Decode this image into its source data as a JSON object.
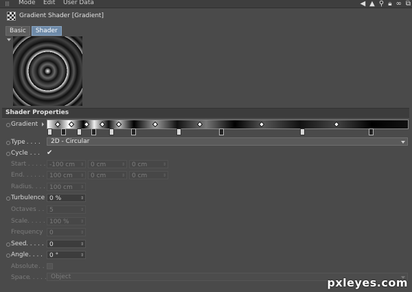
{
  "menu": {
    "items": [
      "Mode",
      "Edit",
      "User Data"
    ]
  },
  "nav_icons": [
    "back-arrow-icon",
    "up-arrow-icon",
    "search-icon",
    "lock-icon",
    "link-icon",
    "settings-icon"
  ],
  "title": "Gradient Shader [Gradient]",
  "tabs": [
    {
      "label": "Basic",
      "active": false
    },
    {
      "label": "Shader",
      "active": true
    }
  ],
  "section": {
    "title": "Shader Properties"
  },
  "params": {
    "gradient_label": "Gradient",
    "type_label": "Type",
    "type_value": "2D - Circular",
    "cycle_label": "Cycle",
    "cycle_checked": "✔",
    "start_label": "Start",
    "start_values": [
      "-100 cm",
      "0 cm",
      "0 cm"
    ],
    "end_label": "End",
    "end_values": [
      "100 cm",
      "0 cm",
      "0 cm"
    ],
    "radius_label": "Radius",
    "radius_value": "100 cm",
    "turbulence_label": "Turbulence",
    "turbulence_value": "0 %",
    "octaves_label": "Octaves",
    "octaves_value": "5",
    "scale_label": "Scale",
    "scale_value": "100 %",
    "frequency_label": "Frequency",
    "frequency_value": "0",
    "seed_label": "Seed",
    "seed_value": "0",
    "angle_label": "Angle",
    "angle_value": "0 °",
    "absolute_label": "Absolute",
    "space_label": "Space",
    "space_value": "Object"
  },
  "spinner_glyph": "⇕",
  "watermark": "pxleyes.com"
}
